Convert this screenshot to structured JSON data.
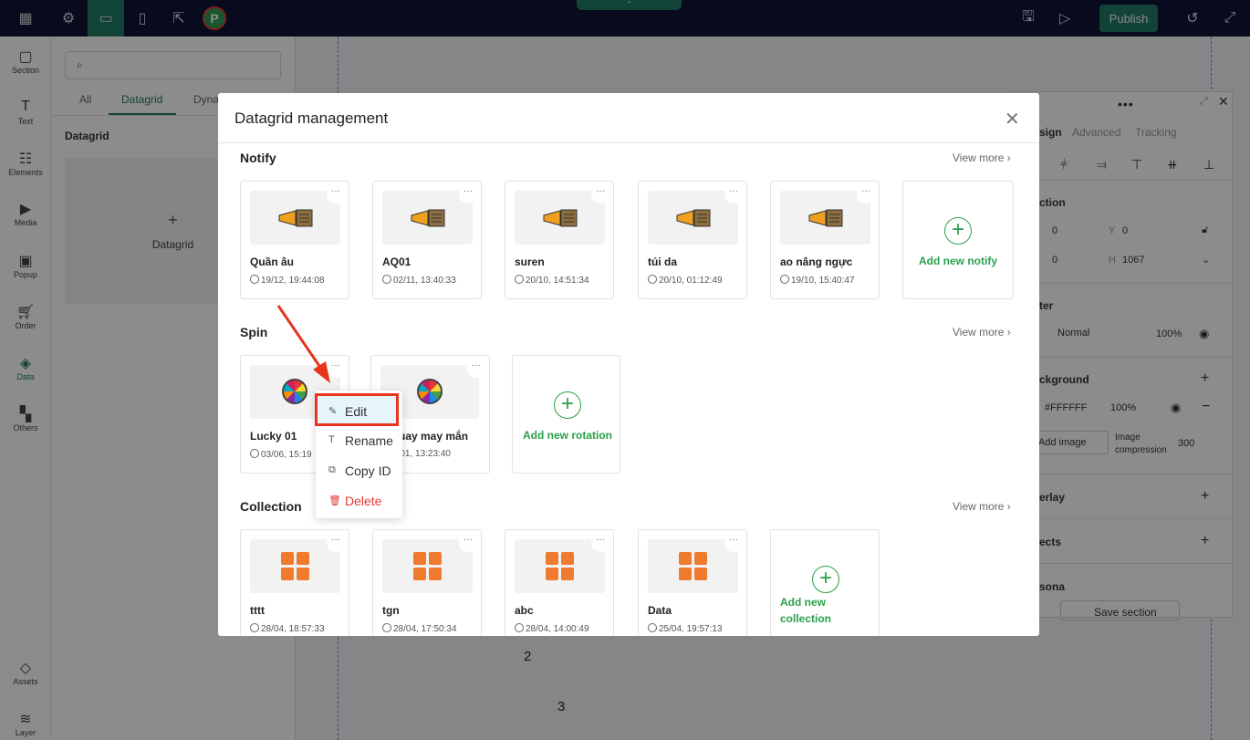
{
  "topbar": {
    "publish_label": "Publish",
    "logo_letter": "P",
    "handle_glyph": "⌃"
  },
  "rail": {
    "items": [
      {
        "label": "Section",
        "icon": "section-icon"
      },
      {
        "label": "Text",
        "icon": "text-icon"
      },
      {
        "label": "Elements",
        "icon": "elements-icon"
      },
      {
        "label": "Media",
        "icon": "media-icon"
      },
      {
        "label": "Popup",
        "icon": "popup-icon"
      },
      {
        "label": "Order",
        "icon": "cart-icon"
      },
      {
        "label": "Data",
        "icon": "data-icon"
      },
      {
        "label": "Others",
        "icon": "others-icon"
      },
      {
        "label": "Assets",
        "icon": "assets-icon"
      },
      {
        "label": "Layer",
        "icon": "layer-icon"
      }
    ]
  },
  "left_panel": {
    "tabs": [
      "All",
      "Datagrid",
      "Dyna"
    ],
    "section_title": "Datagrid",
    "card_label": "Datagrid",
    "card_plus": "+"
  },
  "canvas": {
    "numbers": [
      "2",
      "3"
    ]
  },
  "right_panel": {
    "tabs": [
      "sign",
      "Advanced",
      "Tracking"
    ],
    "position_title": "ction",
    "x_value": "0",
    "y_label": "Y",
    "y_value": "0",
    "w_value": "0",
    "h_label": "H",
    "h_value": "1067",
    "filter_title": "ter",
    "blend_mode": "Normal",
    "opacity": "100%",
    "background_title": "ckground",
    "bg_color": "#FFFFFF",
    "bg_opacity": "100%",
    "add_image": "Add image",
    "image_compression": "Image compression",
    "compression_value": "300",
    "overlay_title": "erlay",
    "effects_title": "ects",
    "persona_title": "sona",
    "save_section": "Save section"
  },
  "modal": {
    "title": "Datagrid management",
    "view_more": "View more",
    "sections": {
      "notify": {
        "title": "Notify",
        "items": [
          {
            "name": "Quần âu",
            "date": "19/12, 19:44:08"
          },
          {
            "name": "AQ01",
            "date": "02/11, 13:40:33"
          },
          {
            "name": "suren",
            "date": "20/10, 14:51:34"
          },
          {
            "name": "túi da",
            "date": "20/10, 01:12:49"
          },
          {
            "name": "ao nâng ngực",
            "date": "19/10, 15:40:47"
          }
        ],
        "add_label": "Add new notify"
      },
      "spin": {
        "title": "Spin",
        "items": [
          {
            "name": "Lucky 01",
            "date": "03/06, 15:19"
          },
          {
            "name": "g quay may mắn",
            "date": "9/01, 13:23:40"
          }
        ],
        "add_label": "Add new rotation"
      },
      "collection": {
        "title": "Collection",
        "items": [
          {
            "name": "tttt",
            "date": "28/04, 18:57:33"
          },
          {
            "name": "tgn",
            "date": "28/04, 17:50:34"
          },
          {
            "name": "abc",
            "date": "28/04, 14:00:49"
          },
          {
            "name": "Data",
            "date": "25/04, 19:57:13"
          }
        ],
        "add_label": "Add new collection"
      }
    }
  },
  "context_menu": {
    "items": [
      {
        "label": "Edit",
        "icon": "edit-icon"
      },
      {
        "label": "Rename",
        "icon": "rename-icon"
      },
      {
        "label": "Copy ID",
        "icon": "copy-icon"
      },
      {
        "label": "Delete",
        "icon": "trash-icon"
      }
    ]
  },
  "colors": {
    "topbar": "#0f1535",
    "accent": "#1f7a63",
    "add_green": "#2aa04a",
    "highlight_border": "#e8341c",
    "annotation_arrow": "#e8341c",
    "danger": "#e53935"
  }
}
